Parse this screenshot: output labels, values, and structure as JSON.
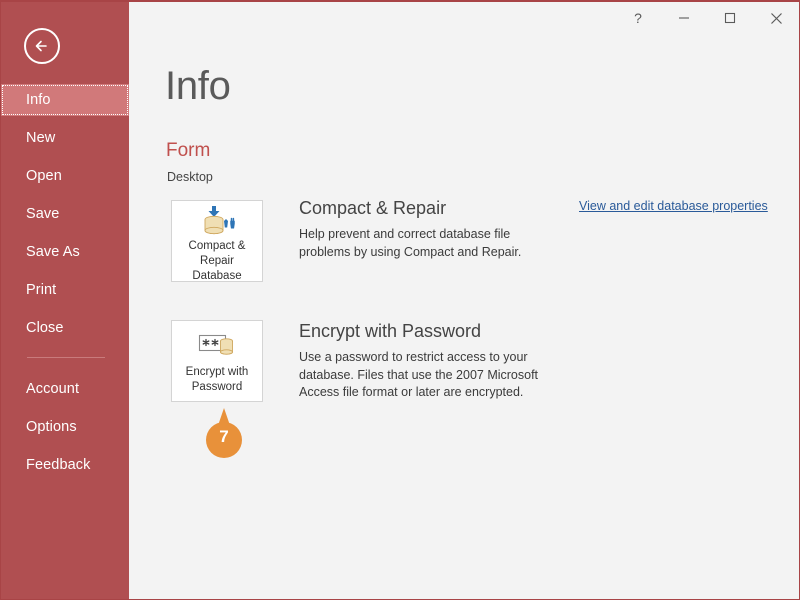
{
  "window": {
    "accent_red": "#b04f51",
    "accent_red_dark": "#a84446",
    "background": "#f3f3f3",
    "controls": {
      "help_label": "?",
      "minimize_label": "—",
      "maximize_label": "□",
      "close_label": "✕"
    }
  },
  "sidebar": {
    "back_icon": "back-arrow-icon",
    "items": [
      {
        "label": "Info",
        "active": true
      },
      {
        "label": "New",
        "active": false
      },
      {
        "label": "Open",
        "active": false
      },
      {
        "label": "Save",
        "active": false
      },
      {
        "label": "Save As",
        "active": false
      },
      {
        "label": "Print",
        "active": false
      },
      {
        "label": "Close",
        "active": false
      },
      {
        "label": "Account",
        "active": false
      },
      {
        "label": "Options",
        "active": false
      },
      {
        "label": "Feedback",
        "active": false
      }
    ]
  },
  "main": {
    "page_title": "Info",
    "document_name": "Form",
    "document_name_color": "#c0504d",
    "document_path": "Desktop",
    "properties_link": "View and edit database properties",
    "properties_link_color": "#2a5a99",
    "actions": [
      {
        "id": "compact-repair",
        "tile_label": "Compact & Repair Database",
        "tile_icon": "database-compact-repair-icon",
        "title": "Compact & Repair",
        "description": "Help prevent and correct database file problems by using Compact and Repair."
      },
      {
        "id": "encrypt-password",
        "tile_label": "Encrypt with Password",
        "tile_icon": "password-database-icon",
        "title": "Encrypt with Password",
        "description": "Use a password to restrict access to your database. Files that use the 2007 Microsoft Access file format or later are encrypted."
      }
    ]
  },
  "badge": {
    "number": "7",
    "color": "#e8913a",
    "target": "encrypt-with-password-tile"
  }
}
